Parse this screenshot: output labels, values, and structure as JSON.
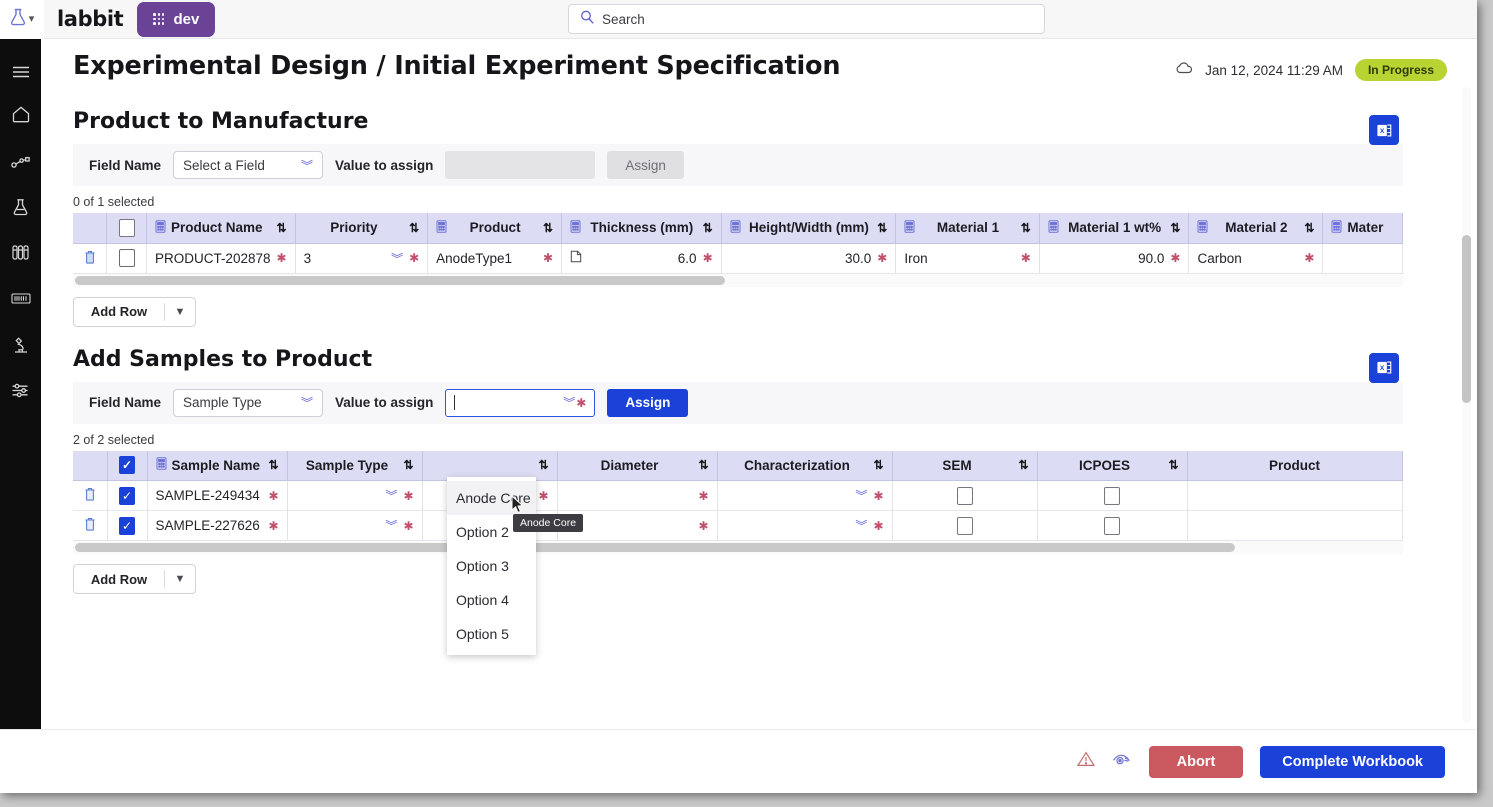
{
  "topbar": {
    "logo": "labbit",
    "env_badge": "dev",
    "search_placeholder": "Search",
    "flask_icon": "flask-icon",
    "grid_icon": "grid-icon",
    "search_icon": "search-icon"
  },
  "sidebar": {
    "items": [
      {
        "name": "menu-toggle",
        "icon": "hamburger-icon"
      },
      {
        "name": "home",
        "icon": "home-icon"
      },
      {
        "name": "workflows",
        "icon": "workflow-graph-icon"
      },
      {
        "name": "experiments",
        "icon": "flask-icon"
      },
      {
        "name": "samples",
        "icon": "test-tubes-icon"
      },
      {
        "name": "barcodes",
        "icon": "barcode-icon"
      },
      {
        "name": "instruments",
        "icon": "microscope-icon"
      },
      {
        "name": "settings",
        "icon": "sliders-icon"
      }
    ]
  },
  "header": {
    "title": "Experimental Design / Initial Experiment Specification",
    "date": "Jan 12, 2024 11:29 AM",
    "status": "In Progress",
    "cloud_icon": "cloud-icon"
  },
  "sections": [
    {
      "title": "Product to Manufacture",
      "export_icon": "excel-export-icon",
      "assign": {
        "field_label": "Field Name",
        "field_value": "Select a Field",
        "value_label": "Value to assign",
        "value_text": "",
        "assign_label": "Assign",
        "assign_enabled": false
      },
      "selection": "0 of 1 selected",
      "columns": [
        {
          "label": "",
          "type": "action"
        },
        {
          "label": "",
          "type": "check"
        },
        {
          "label": "Product Name",
          "icon": "calculator-icon",
          "sortable": true,
          "align": "left"
        },
        {
          "label": "Priority",
          "sortable": true
        },
        {
          "label": "Product",
          "icon": "calculator-icon",
          "sortable": true
        },
        {
          "label": "Thickness (mm)",
          "icon": "calculator-icon",
          "sortable": true
        },
        {
          "label": "Height/Width (mm)",
          "icon": "calculator-icon",
          "sortable": true
        },
        {
          "label": "Material 1",
          "icon": "calculator-icon",
          "sortable": true
        },
        {
          "label": "Material 1 wt%",
          "icon": "calculator-icon",
          "sortable": true
        },
        {
          "label": "Material 2",
          "icon": "calculator-icon",
          "sortable": true
        },
        {
          "label": "Mater",
          "icon": "calculator-icon",
          "sortable": false
        }
      ],
      "rows": [
        {
          "checked": false,
          "product_name": "PRODUCT-202878",
          "priority": "3",
          "product": "AnodeType1",
          "thickness": "6.0",
          "height_width": "30.0",
          "material_1": "Iron",
          "material_1_wt": "90.0",
          "material_2": "Carbon",
          "material_3": ""
        }
      ],
      "add_row": {
        "label": "Add Row",
        "chevron": "chevron-down-icon"
      },
      "hscroll_thumb_pct": 49
    },
    {
      "title": "Add Samples to Product",
      "export_icon": "excel-export-icon",
      "assign": {
        "field_label": "Field Name",
        "field_value": "Sample Type",
        "value_label": "Value to assign",
        "value_text": "",
        "assign_label": "Assign",
        "assign_enabled": true
      },
      "selection": "2 of 2 selected",
      "columns": [
        {
          "label": "",
          "type": "action"
        },
        {
          "label": "",
          "type": "check",
          "checked": true
        },
        {
          "label": "Sample Name",
          "icon": "calculator-icon",
          "sortable": true,
          "align": "left"
        },
        {
          "label": "Sample Type",
          "sortable": true
        },
        {
          "label": "",
          "sortable": true
        },
        {
          "label": "Diameter",
          "sortable": true
        },
        {
          "label": "Characterization",
          "sortable": true
        },
        {
          "label": "SEM",
          "sortable": true
        },
        {
          "label": "ICPOES",
          "sortable": true
        },
        {
          "label": "Product",
          "sortable": false
        }
      ],
      "rows": [
        {
          "checked": true,
          "sample_name": "SAMPLE-249434",
          "sample_type": "",
          "hidden_col": "",
          "diameter": "",
          "characterization": "",
          "sem": false,
          "icpoes": false,
          "product": ""
        },
        {
          "checked": true,
          "sample_name": "SAMPLE-227626",
          "sample_type": "",
          "hidden_col": "",
          "diameter": "",
          "characterization": "",
          "sem": false,
          "icpoes": false,
          "product": ""
        }
      ],
      "add_row": {
        "label": "Add Row",
        "chevron": "chevron-down-icon"
      },
      "hscroll_thumb_pct": 86
    }
  ],
  "dropdown": {
    "options": [
      "Anode Core",
      "Option 2",
      "Option 3",
      "Option 4",
      "Option 5"
    ],
    "highlighted": "Anode Core",
    "tooltip": "Anode Core"
  },
  "footer": {
    "warning_icon": "warning-triangle-icon",
    "eye_icon": "eye-review-icon",
    "abort_label": "Abort",
    "complete_label": "Complete Workbook"
  },
  "colors": {
    "accent_blue": "#1a41d8",
    "purple": "#6a4296",
    "status_green": "#b7d432",
    "abort_red": "#c9595f",
    "header_lilac": "#dcdcf4",
    "required_star": "#c0506b"
  }
}
